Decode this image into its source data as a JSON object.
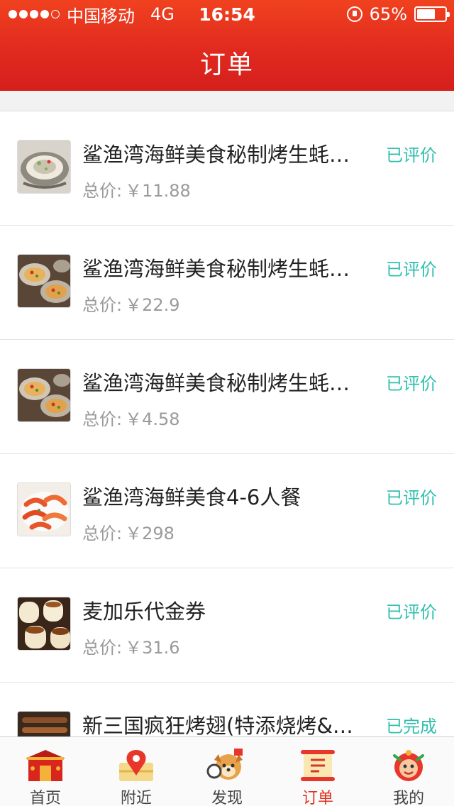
{
  "status_bar": {
    "carrier": "中国移动",
    "network": "4G",
    "time": "16:54",
    "battery": "65%",
    "battery_level": 0.65,
    "signal_bars": 4
  },
  "header": {
    "title": "订单"
  },
  "orders": [
    {
      "name": "鲨渔湾海鲜美食秘制烤生蚝…",
      "price_label": "总价:",
      "price": "￥11.88",
      "status": "已评价",
      "thumb": "oyster"
    },
    {
      "name": "鲨渔湾海鲜美食秘制烤生蚝…",
      "price_label": "总价:",
      "price": "￥22.9",
      "status": "已评价",
      "thumb": "grilled-oyster"
    },
    {
      "name": "鲨渔湾海鲜美食秘制烤生蚝…",
      "price_label": "总价:",
      "price": "￥4.58",
      "status": "已评价",
      "thumb": "grilled-oyster"
    },
    {
      "name": "鲨渔湾海鲜美食4-6人餐",
      "price_label": "总价:",
      "price": "￥298",
      "status": "已评价",
      "thumb": "shrimp"
    },
    {
      "name": "麦加乐代金券",
      "price_label": "总价:",
      "price": "￥31.6",
      "status": "已评价",
      "thumb": "pudding"
    },
    {
      "name": "新三国疯狂烤翅(特添烧烤&…",
      "price_label": "",
      "price": "",
      "status": "已完成",
      "thumb": "skewers"
    }
  ],
  "tabs": [
    {
      "label": "首页",
      "icon": "gate-icon",
      "active": false
    },
    {
      "label": "附近",
      "icon": "map-pin-icon",
      "active": false
    },
    {
      "label": "发现",
      "icon": "dog-explore-icon",
      "active": false
    },
    {
      "label": "订单",
      "icon": "scroll-order-icon",
      "active": true
    },
    {
      "label": "我的",
      "icon": "lion-mascot-icon",
      "active": false
    }
  ],
  "colors": {
    "header_red": "#e12a1f",
    "status_teal": "#2fbfae",
    "tab_active": "#e0311f"
  }
}
